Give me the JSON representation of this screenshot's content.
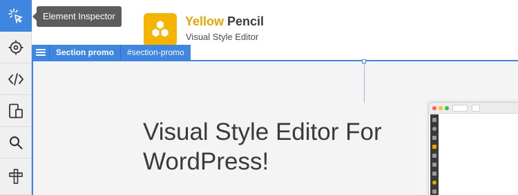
{
  "toolbar": {
    "tools": [
      {
        "name": "element-inspector",
        "icon": "cursor-select-icon",
        "active": true
      },
      {
        "name": "target",
        "icon": "crosshair-icon",
        "active": false
      },
      {
        "name": "code",
        "icon": "code-icon",
        "active": false
      },
      {
        "name": "responsive",
        "icon": "devices-icon",
        "active": false
      },
      {
        "name": "search",
        "icon": "search-icon",
        "active": false
      },
      {
        "name": "measure",
        "icon": "ruler-icon",
        "active": false
      }
    ]
  },
  "tooltip": {
    "text": "Element Inspector"
  },
  "brand": {
    "title_highlight": "Yellow",
    "title_rest": " Pencil",
    "subtitle": "Visual Style Editor",
    "logo_color": "#f4b400",
    "logo_icon": "hexagons-icon"
  },
  "selection": {
    "label": "Section promo",
    "selector": "#section-promo",
    "menu_icon": "hamburger-icon"
  },
  "content": {
    "heading": "Visual Style Editor For WordPress!"
  },
  "colors": {
    "accent": "#3f86e0",
    "brand_yellow": "#e2a800",
    "tooltip_bg": "#5c5c5c"
  }
}
